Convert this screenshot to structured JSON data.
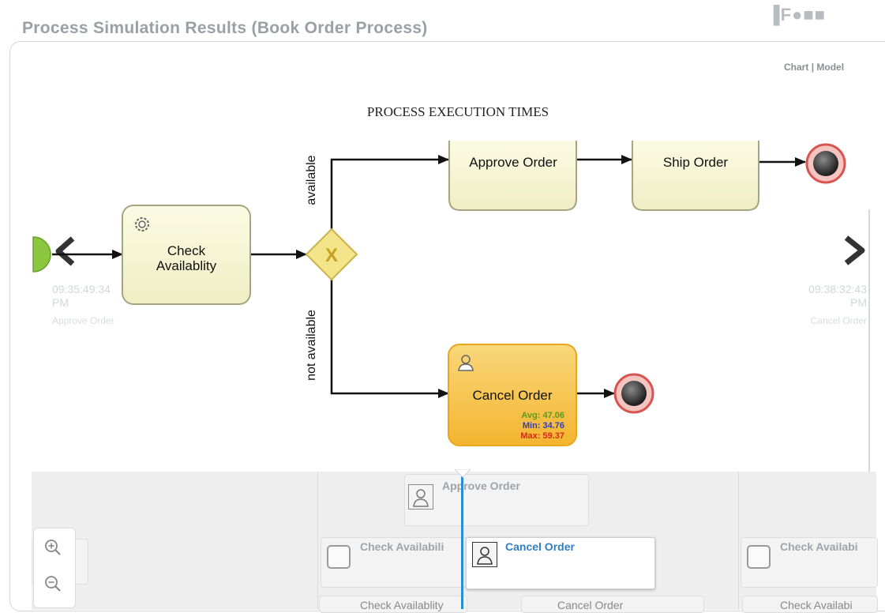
{
  "header": {
    "title": "Process Simulation Results (Book Order Process)",
    "toolbar_icons": "▐F●■■"
  },
  "view_toggle": {
    "chart": "Chart",
    "separator": "|",
    "model": "Model"
  },
  "chart_title": "PROCESS EXECUTION TIMES",
  "diagram": {
    "start_task": "Check Availablity",
    "gateway_label": "X",
    "path_available": "available",
    "path_not_available": "not available",
    "task_approve": "Approve Order",
    "task_ship": "Ship Order",
    "task_cancel": "Cancel Order",
    "cancel_stats": {
      "avg": "Avg: 47.06",
      "min": "Min: 34.76",
      "max": "Max: 59.37"
    }
  },
  "nav": {
    "left_time_1": "09:35:49:34",
    "left_time_2": "PM",
    "left_event": "Approve Order",
    "right_time_1": "09:38:32:43",
    "right_time_2": "PM",
    "right_event": "Cancel Order"
  },
  "timeline": {
    "approve_order": "Approve Order",
    "check_left": "Check Availabili",
    "cancel_active": "Cancel Order",
    "check_right": "Check Availabi",
    "bottom_check": "Check Availablity",
    "bottom_cancel": "Cancel Order",
    "bottom_check_right": "Check Availabi"
  },
  "colors": {
    "task_fill": "#f7f6d0",
    "task_stroke": "#a5a583",
    "cancel_fill": "#f7c64a",
    "gateway_fill": "#f3e48a",
    "start_event": "#8cc63f",
    "end_event_ring": "#d9534f",
    "stat_avg": "#5a9a1a",
    "stat_min": "#2d3fc0",
    "stat_max": "#d52b1e",
    "cursor": "#2b8fcf"
  }
}
